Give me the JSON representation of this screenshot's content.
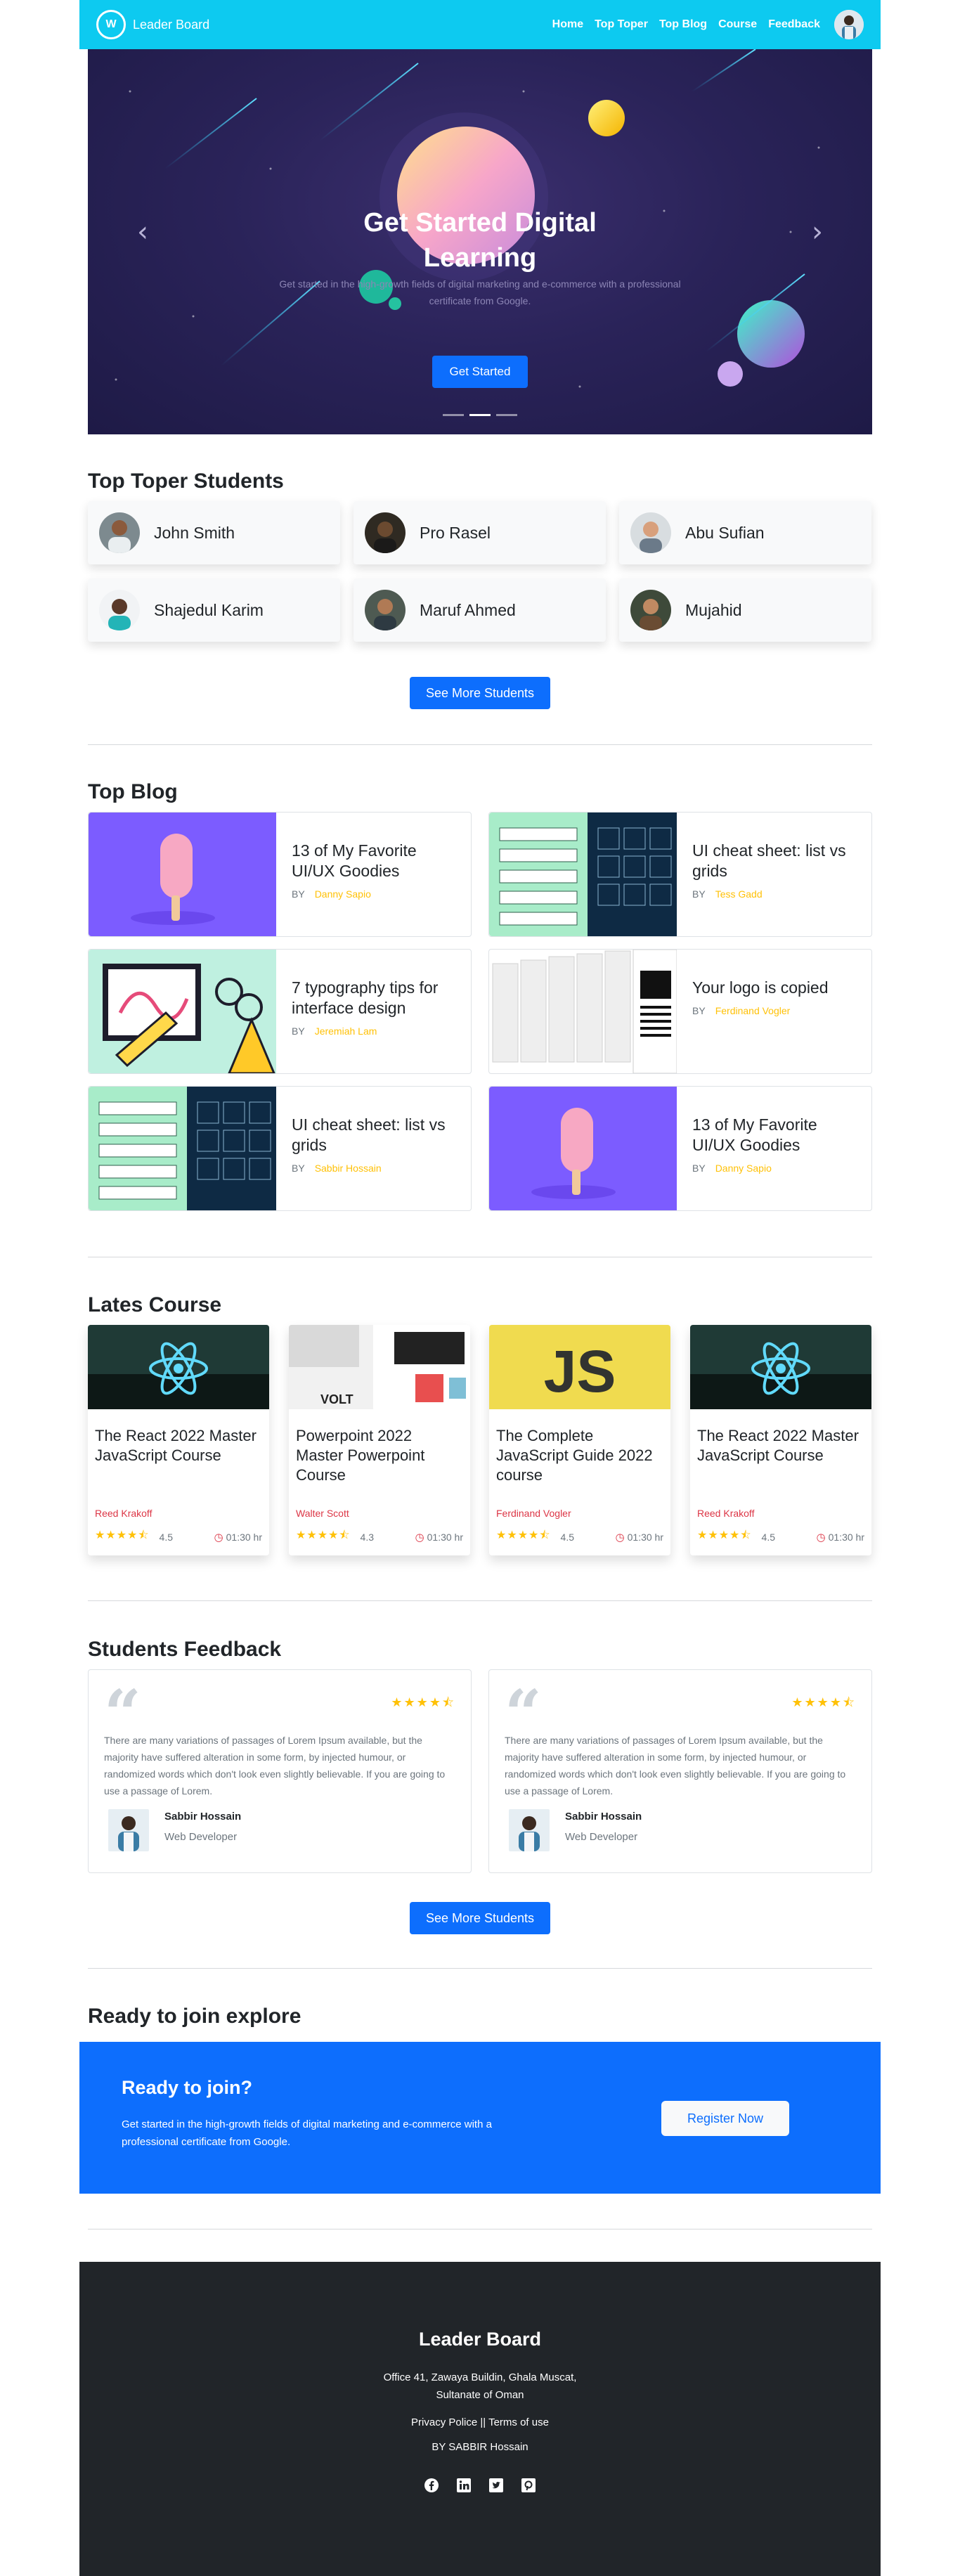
{
  "nav": {
    "brand": "Leader Board",
    "brand_logo_letter": "W",
    "links": [
      "Home",
      "Top Toper",
      "Top Blog",
      "Course",
      "Feedback"
    ]
  },
  "hero": {
    "title": "Get Started Digital Learning",
    "text": "Get started in the high-growth fields of digital marketing and e-commerce with a professional certificate from Google.",
    "button": "Get Started",
    "prev": "‹",
    "next": "›"
  },
  "students": {
    "title": "Top Toper Students",
    "list": [
      "John Smith",
      "Pro Rasel",
      "Abu Sufian",
      "Shajedul Karim",
      "Maruf Ahmed",
      "Mujahid"
    ],
    "button": "See More Students"
  },
  "blog": {
    "title": "Top Blog",
    "by_label": "BY",
    "posts": [
      {
        "title": "13 of My Favorite UI/UX Goodies",
        "author": "Danny Sapio",
        "image": "popsicle-image"
      },
      {
        "title": "UI cheat sheet: list vs grids",
        "author": "Tess Gadd",
        "image": "list-grid-image"
      },
      {
        "title": "7 typography tips for interface design",
        "author": "Jeremiah Lam",
        "image": "typography-image"
      },
      {
        "title": "Your logo is copied",
        "author": "Ferdinand Vogler",
        "image": "logo-copy-image"
      },
      {
        "title": "UI cheat sheet: list vs grids",
        "author": "Sabbir Hossain",
        "image": "list-grid-image"
      },
      {
        "title": "13 of My Favorite UI/UX Goodies",
        "author": "Danny Sapio",
        "image": "popsicle-image"
      }
    ]
  },
  "courses": {
    "title": "Lates Course",
    "list": [
      {
        "title": "The React 2022 Master JavaScript Course",
        "author": "Reed Krakoff",
        "rating": "4.5",
        "duration": "01:30 hr",
        "image": "react-image"
      },
      {
        "title": "Powerpoint 2022 Master Powerpoint Course",
        "author": "Walter Scott",
        "rating": "4.3",
        "duration": "01:30 hr",
        "image": "powerpoint-image",
        "image_text": "VOLT"
      },
      {
        "title": "The Complete JavaScript Guide 2022 course",
        "author": "Ferdinand Vogler",
        "rating": "4.5",
        "duration": "01:30 hr",
        "image": "javascript-image",
        "image_text": "JS"
      },
      {
        "title": "The React 2022 Master JavaScript Course",
        "author": "Reed Krakoff",
        "rating": "4.5",
        "duration": "01:30 hr",
        "image": "react-image"
      }
    ],
    "stars": "★★★★⯪"
  },
  "feedback": {
    "title": "Students Feedback",
    "quote_mark": "“",
    "stars": "★★★★⯪",
    "items": [
      {
        "text": "There are many variations of passages of Lorem Ipsum available, but the majority have suffered alteration in some form, by injected humour, or randomized words which don't look even slightly believable. If you are going to use a passage of Lorem.",
        "name": "Sabbir Hossain",
        "role": "Web Developer"
      },
      {
        "text": "There are many variations of passages of Lorem Ipsum available, but the majority have suffered alteration in some form, by injected humour, or randomized words which don't look even slightly believable. If you are going to use a passage of Lorem.",
        "name": "Sabbir Hossain",
        "role": "Web Developer"
      }
    ],
    "button": "See More Students"
  },
  "join": {
    "section_title": "Ready to join explore",
    "title": "Ready to join?",
    "text": "Get started in the high-growth fields of digital marketing and e-commerce with a professional certificate from Google.",
    "button": "Register Now"
  },
  "footer": {
    "title": "Leader Board",
    "address": "Office 41, Zawaya Buildin, Ghala Muscat, Sultanate of Oman",
    "links": "Privacy Police || Terms of use",
    "by": "BY SABBIR Hossain",
    "social": [
      "facebook-icon",
      "linkedin-icon",
      "twitter-icon",
      "pinterest-icon"
    ]
  },
  "colors": {
    "navbar": "#0dcaf0",
    "primary": "#0d6efd",
    "star": "#ffc107",
    "author_red": "#dc3545",
    "footer": "#212529",
    "hero_bg": "#2a2359"
  }
}
